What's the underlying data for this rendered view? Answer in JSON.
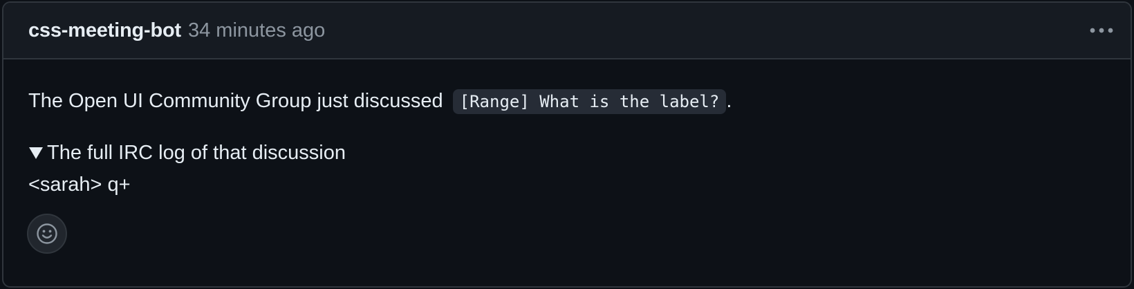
{
  "comment": {
    "author": "css-meeting-bot",
    "timestamp": "34 minutes ago",
    "body": {
      "intro_text": "The Open UI Community Group just discussed ",
      "issue_link_label": "[Range] What is the label?",
      "intro_suffix": ".",
      "details_summary": "The full IRC log of that discussion",
      "log_lines": [
        "<sarah> q+"
      ]
    },
    "icons": {
      "menu": "kebab-horizontal-icon",
      "reaction": "smiley-icon",
      "disclosure": "triangle-down-icon"
    }
  },
  "colors": {
    "background": "#0d1117",
    "header_background": "#161b22",
    "border": "#30363d",
    "text_primary": "#e6edf3",
    "text_muted": "#8d96a0",
    "code_background": "#262c36"
  }
}
